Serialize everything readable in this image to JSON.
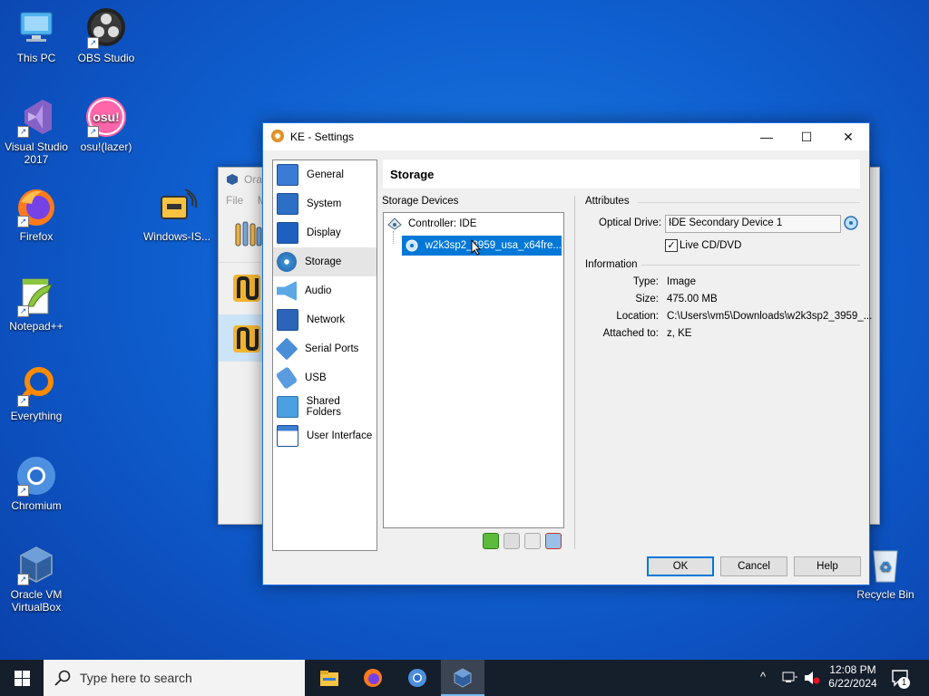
{
  "desktop": {
    "icons": [
      {
        "label": "This PC"
      },
      {
        "label": "OBS Studio"
      },
      {
        "label": "Visual Studio 2017"
      },
      {
        "label": "osu!(lazer)"
      },
      {
        "label": "Firefox"
      },
      {
        "label": "Windows-IS..."
      },
      {
        "label": "Notepad++"
      },
      {
        "label": "Everything"
      },
      {
        "label": "Chromium"
      },
      {
        "label": "Oracle VM VirtualBox"
      },
      {
        "label": "Recycle Bin"
      }
    ],
    "osu_text": "osu!"
  },
  "background_window": {
    "title": "Ora",
    "menu": [
      "File",
      "M"
    ]
  },
  "dialog": {
    "title": "KE - Settings",
    "controls": {
      "minimize": "—",
      "maximize": "☐",
      "close": "✕"
    },
    "categories": [
      {
        "label": "General",
        "color": "#3a7bd5"
      },
      {
        "label": "System",
        "color": "#2d6fc4"
      },
      {
        "label": "Display",
        "color": "#1f5fbf"
      },
      {
        "label": "Storage",
        "color": "#3a8fd0"
      },
      {
        "label": "Audio",
        "color": "#5aa9e6"
      },
      {
        "label": "Network",
        "color": "#2b64b8"
      },
      {
        "label": "Serial Ports",
        "color": "#4a8ed8"
      },
      {
        "label": "USB",
        "color": "#5b9be0"
      },
      {
        "label": "Shared Folders",
        "color": "#4aa0e0"
      },
      {
        "label": "User Interface",
        "color": "#3e7fcf"
      }
    ],
    "selected_category": "Storage",
    "page_title": "Storage",
    "storage_devices_label": "Storage Devices",
    "controller_label": "Controller: IDE",
    "selected_disk": "w2k3sp2_3959_usa_x64fre...",
    "attributes_label": "Attributes",
    "optical_drive_label": "Optical Drive:",
    "optical_drive_value": "IDE Secondary Device 1",
    "live_cd_label": "Live CD/DVD",
    "live_cd_checked": true,
    "information_label": "Information",
    "info": [
      {
        "key": "Type:",
        "value": "Image"
      },
      {
        "key": "Size:",
        "value": "475.00 MB"
      },
      {
        "key": "Location:",
        "value": "C:\\Users\\vm5\\Downloads\\w2k3sp2_3959_..."
      },
      {
        "key": "Attached to:",
        "value": "z, KE"
      }
    ],
    "buttons": {
      "ok": "OK",
      "cancel": "Cancel",
      "help": "Help"
    }
  },
  "taskbar": {
    "search_placeholder": "Type here to search",
    "time": "12:08 PM",
    "date": "6/22/2024",
    "notification_count": "1"
  }
}
